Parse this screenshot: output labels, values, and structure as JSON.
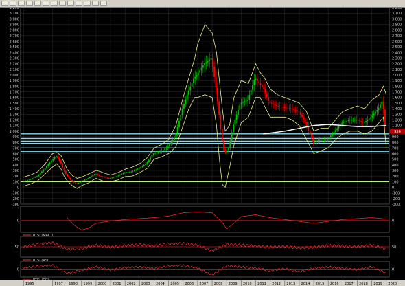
{
  "toolbar": {
    "buttons": [
      "drag-icon",
      "crosshair-icon",
      "zoom-icon",
      "line-icon",
      "rectangle-icon",
      "text-icon",
      "print-icon",
      "copy-icon",
      "help-icon",
      "tool-icon",
      "tool-icon",
      "tool-icon",
      "tool-icon"
    ]
  },
  "colors": {
    "background": "#000000",
    "up_candle": "#00c800",
    "down_candle": "#ff0000",
    "bands": "#e8f08c",
    "ma_line": "#ffffff",
    "grid": "#2e2e2e",
    "indicator_line": "#ff3030",
    "support_bands": "#7fdcf0",
    "base_line": "#b8f080"
  },
  "chart_data": [
    {
      "type": "line",
      "name": "price",
      "ylim": [
        -300,
        3200
      ],
      "y_ticks": [
        3200,
        3100,
        3000,
        2900,
        2800,
        2700,
        2600,
        2500,
        2400,
        2300,
        2200,
        2100,
        2000,
        1900,
        1800,
        1700,
        1600,
        1500,
        1400,
        1300,
        1200,
        1100,
        1000,
        900,
        800,
        700,
        600,
        500,
        400,
        300,
        200,
        100,
        0,
        -100,
        -200,
        -300
      ],
      "y_tick_labels": [
        "3 200",
        "3 100",
        "3 000",
        "2 900",
        "2 800",
        "2 700",
        "2 600",
        "2 500",
        "2 400",
        "2 300",
        "2 200",
        "2 100",
        "2 000",
        "1 900",
        "1 800",
        "1 700",
        "1 600",
        "1 500",
        "1 400",
        "1 300",
        "1 200",
        "1 100",
        "1 000",
        "900",
        "800",
        "700",
        "600",
        "500",
        "400",
        "300",
        "200",
        "100",
        "0",
        "-100",
        "-200",
        "-300"
      ],
      "last_value_label": "956",
      "x": [
        1995.0,
        1995.5,
        1996.0,
        1996.5,
        1997.0,
        1997.3,
        1997.6,
        1997.8,
        1998.0,
        1998.4,
        1998.7,
        1999.0,
        1999.5,
        2000.0,
        2000.3,
        2000.6,
        2001.0,
        2001.5,
        2002.0,
        2002.5,
        2003.0,
        2003.5,
        2004.0,
        2004.5,
        2005.0,
        2005.5,
        2006.0,
        2006.4,
        2006.8,
        2007.0,
        2007.5,
        2008.0,
        2008.3,
        2008.5,
        2008.7,
        2008.9,
        2009.2,
        2009.5,
        2010.0,
        2010.5,
        2011.0,
        2011.3,
        2011.6,
        2012.0,
        2012.5,
        2013.0,
        2013.5,
        2014.0,
        2014.5,
        2015.0,
        2015.5,
        2016.0,
        2016.5,
        2017.0,
        2017.5,
        2018.0,
        2018.5,
        2019.0,
        2019.5,
        2019.8,
        2020.0
      ],
      "values": [
        100,
        140,
        200,
        330,
        480,
        560,
        450,
        320,
        220,
        100,
        60,
        100,
        160,
        240,
        200,
        170,
        160,
        200,
        260,
        280,
        340,
        420,
        600,
        640,
        720,
        900,
        1400,
        1700,
        1950,
        2000,
        2200,
        2300,
        1800,
        1350,
        900,
        600,
        700,
        1100,
        1500,
        1550,
        1950,
        1850,
        1750,
        1500,
        1450,
        1420,
        1400,
        1350,
        1150,
        800,
        850,
        850,
        1000,
        1150,
        1200,
        1200,
        1150,
        1250,
        1400,
        1550,
        1000
      ],
      "bands_upper": [
        180,
        220,
        280,
        420,
        600,
        620,
        560,
        440,
        320,
        200,
        160,
        180,
        240,
        300,
        280,
        250,
        220,
        260,
        320,
        360,
        420,
        520,
        700,
        760,
        850,
        1100,
        1600,
        1950,
        2300,
        2550,
        2900,
        2750,
        2400,
        1900,
        1400,
        1000,
        1100,
        1600,
        1900,
        1850,
        2200,
        2050,
        1950,
        1750,
        1650,
        1600,
        1550,
        1500,
        1350,
        1000,
        1050,
        1050,
        1200,
        1350,
        1400,
        1450,
        1400,
        1550,
        1650,
        1800,
        1650
      ],
      "bands_lower": [
        20,
        60,
        120,
        240,
        360,
        420,
        320,
        200,
        120,
        20,
        -20,
        30,
        80,
        160,
        130,
        100,
        100,
        130,
        190,
        200,
        260,
        330,
        500,
        540,
        600,
        720,
        1100,
        1400,
        1600,
        1600,
        1650,
        1600,
        1100,
        500,
        50,
        0,
        350,
        750,
        1150,
        1250,
        1600,
        1600,
        1450,
        1250,
        1250,
        1250,
        1200,
        1100,
        850,
        600,
        650,
        700,
        850,
        950,
        1000,
        1000,
        950,
        1000,
        1150,
        1250,
        700
      ],
      "ma_x": [
        2011.5,
        2013.0,
        2014.0,
        2015.0,
        2016.0,
        2017.0,
        2018.0,
        2019.0,
        2020.0
      ],
      "ma_values": [
        950,
        1000,
        1050,
        1100,
        1120,
        1100,
        1080,
        1080,
        1100
      ],
      "horizontal_lines": [
        100,
        640,
        700,
        780,
        820,
        870,
        950
      ]
    },
    {
      "type": "line",
      "name": "RTSI (MACD)",
      "ylim": [
        -250,
        300
      ],
      "y_ticks": [
        0
      ],
      "y_tick_labels": [
        "0"
      ],
      "x": [
        1998.0,
        1998.5,
        1999.0,
        1999.5,
        2000.0,
        2001.0,
        2002.0,
        2003.0,
        2004.0,
        2005.0,
        2006.0,
        2007.0,
        2008.0,
        2008.7,
        2009.0,
        2009.5,
        2010.0,
        2011.0,
        2012.0,
        2013.0,
        2014.0,
        2015.0,
        2016.0,
        2017.0,
        2018.0,
        2019.0,
        2020.0
      ],
      "values": [
        60,
        -100,
        -200,
        -160,
        -60,
        -10,
        20,
        40,
        60,
        90,
        160,
        180,
        160,
        -40,
        -180,
        -60,
        80,
        120,
        60,
        20,
        -20,
        -60,
        -20,
        20,
        40,
        60,
        30
      ]
    },
    {
      "type": "line",
      "name": "RTSI (RSI)",
      "ylim": [
        0,
        100
      ],
      "y_ticks": [
        50
      ],
      "y_tick_labels": [
        "50"
      ],
      "x": [
        1995.0,
        1996.0,
        1997.0,
        1998.0,
        1999.0,
        2000.0,
        2001.0,
        2002.0,
        2003.0,
        2004.0,
        2005.0,
        2006.0,
        2007.0,
        2008.0,
        2009.0,
        2010.0,
        2011.0,
        2012.0,
        2013.0,
        2014.0,
        2015.0,
        2016.0,
        2017.0,
        2018.0,
        2019.0,
        2020.0
      ],
      "values": [
        50,
        62,
        70,
        38,
        42,
        58,
        48,
        56,
        60,
        54,
        64,
        66,
        58,
        30,
        62,
        58,
        54,
        48,
        52,
        44,
        48,
        56,
        54,
        50,
        58,
        40
      ]
    },
    {
      "type": "line",
      "name": "RTSI (CCI)",
      "ylim": [
        -300,
        300
      ],
      "y_ticks": [
        0
      ],
      "y_tick_labels": [
        "0"
      ],
      "x": [
        1995.0,
        1996.0,
        1997.0,
        1998.0,
        1999.0,
        2000.0,
        2001.0,
        2002.0,
        2003.0,
        2004.0,
        2005.0,
        2006.0,
        2007.0,
        2008.0,
        2009.0,
        2010.0,
        2011.0,
        2012.0,
        2013.0,
        2014.0,
        2015.0,
        2016.0,
        2017.0,
        2018.0,
        2019.0,
        2020.0
      ],
      "values": [
        40,
        110,
        150,
        -160,
        -40,
        90,
        -30,
        60,
        80,
        20,
        120,
        140,
        40,
        -220,
        130,
        80,
        40,
        -60,
        20,
        -100,
        40,
        80,
        30,
        -20,
        90,
        -150
      ]
    }
  ],
  "x_axis": {
    "ticks": [
      1995,
      1997,
      1998,
      1999,
      2000,
      2001,
      2002,
      2003,
      2004,
      2005,
      2006,
      2007,
      2008,
      2009,
      2010,
      2011,
      2012,
      2013,
      2014,
      2015,
      2016,
      2017,
      2018,
      2019,
      2020
    ],
    "labels": [
      "1995",
      "1997",
      "1998",
      "1999",
      "2000",
      "2001",
      "2002",
      "2003",
      "2004",
      "2005",
      "2006",
      "2007",
      "2008",
      "2009",
      "2010",
      "2011",
      "2012",
      "2013",
      "2014",
      "2015",
      "2016",
      "2017",
      "2018",
      "2019",
      "2020"
    ]
  }
}
